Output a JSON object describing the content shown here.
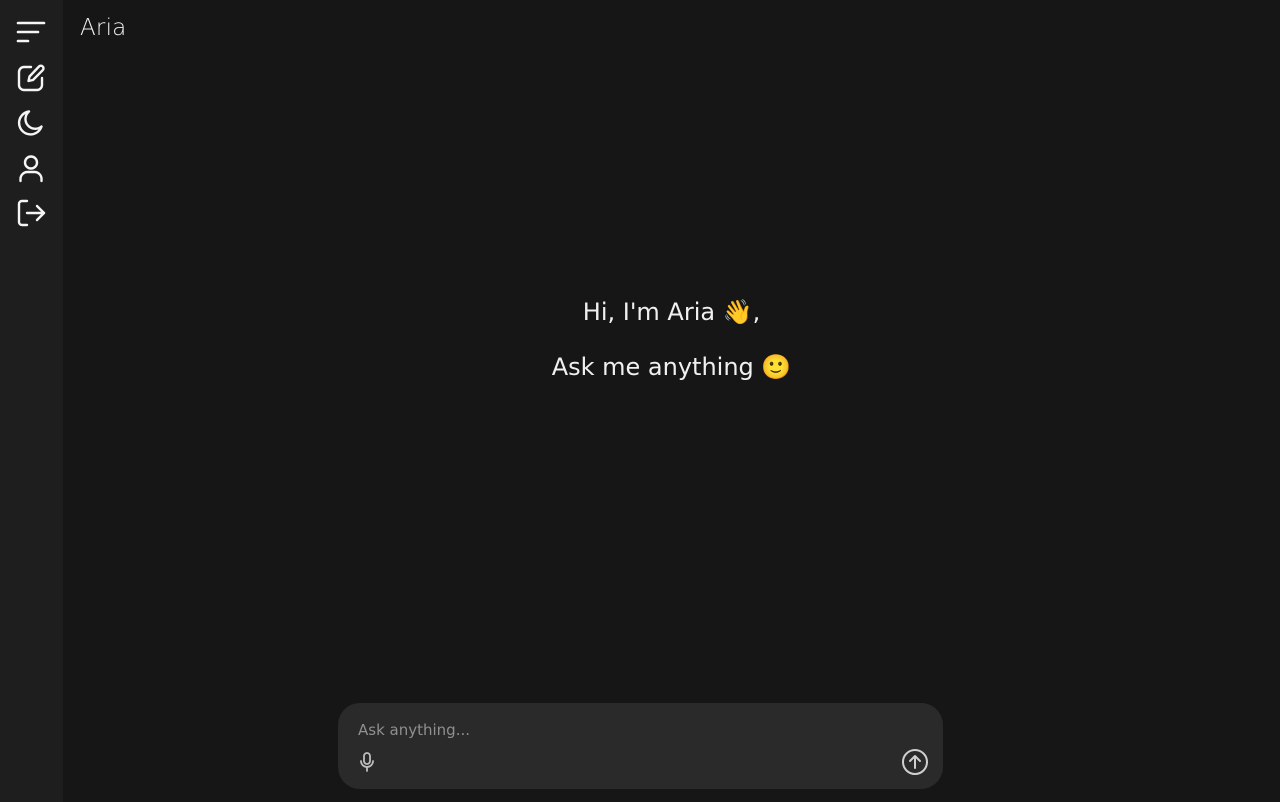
{
  "app": {
    "brand": "Aria"
  },
  "sidebar": {
    "items": [
      {
        "icon": "menu-icon"
      },
      {
        "icon": "new-chat-icon"
      },
      {
        "icon": "moon-icon"
      },
      {
        "icon": "user-icon"
      },
      {
        "icon": "logout-icon"
      }
    ]
  },
  "welcome": {
    "greeting": "Hi, I'm Aria 👋,",
    "subtitle": "Ask me anything 🙂"
  },
  "composer": {
    "placeholder": "Ask anything...",
    "value": "",
    "mic_icon": "microphone-icon",
    "send_icon": "send-arrow-up-icon"
  },
  "colors": {
    "background": "#161616",
    "sidebar": "#1e1e1e",
    "composer": "#2a2a2a",
    "text": "#f0f0f0",
    "placeholder": "#8f8f8f"
  }
}
